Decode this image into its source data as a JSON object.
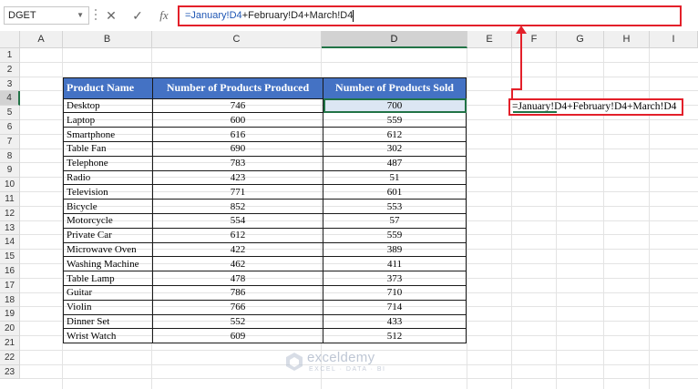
{
  "formula_bar": {
    "name_box": "DGET",
    "cancel_symbol": "✕",
    "enter_symbol": "✓",
    "fx_label": "fx",
    "formula_part1": "=January!D4",
    "formula_part2": "+February!D4+March!D4"
  },
  "columns": [
    "A",
    "B",
    "C",
    "D",
    "E",
    "F",
    "G",
    "H",
    "I"
  ],
  "rows": [
    "1",
    "2",
    "3",
    "4",
    "5",
    "6",
    "7",
    "8",
    "9",
    "10",
    "11",
    "12",
    "13",
    "14",
    "15",
    "16",
    "17",
    "18",
    "19",
    "20",
    "21",
    "22",
    "23"
  ],
  "active_cell": "D4",
  "table": {
    "headers": [
      "Product Name",
      "Number of Products Produced",
      "Number of Products Sold"
    ],
    "rows": [
      [
        "Desktop",
        "746",
        "700"
      ],
      [
        "Laptop",
        "600",
        "559"
      ],
      [
        "Smartphone",
        "616",
        "612"
      ],
      [
        "Table Fan",
        "690",
        "302"
      ],
      [
        "Telephone",
        "783",
        "487"
      ],
      [
        "Radio",
        "423",
        "51"
      ],
      [
        "Television",
        "771",
        "601"
      ],
      [
        "Bicycle",
        "852",
        "553"
      ],
      [
        "Motorcycle",
        "554",
        "57"
      ],
      [
        "Private Car",
        "612",
        "559"
      ],
      [
        "Microwave Oven",
        "422",
        "389"
      ],
      [
        "Washing Machine",
        "462",
        "411"
      ],
      [
        "Table Lamp",
        "478",
        "373"
      ],
      [
        "Guitar",
        "786",
        "710"
      ],
      [
        "Violin",
        "766",
        "714"
      ],
      [
        "Dinner Set",
        "552",
        "433"
      ],
      [
        "Wrist Watch",
        "609",
        "512"
      ]
    ]
  },
  "callout_text": "=January!D4+February!D4+March!D4",
  "watermark": {
    "name": "exceldemy",
    "tagline": "EXCEL · DATA · BI"
  },
  "colors": {
    "header_fill": "#4472c4",
    "highlight_border": "#e3202a",
    "selection": "#217346"
  }
}
